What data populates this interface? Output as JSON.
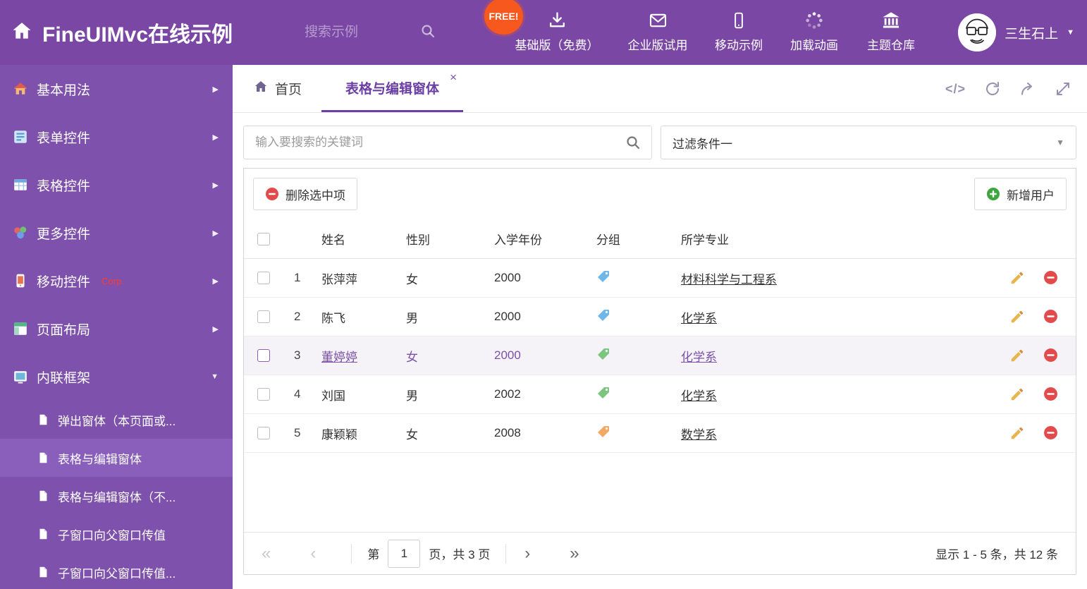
{
  "colors": {
    "brand_purple": "#7A47A5",
    "sidebar_purple": "#7E51AC",
    "sidebar_selected": "#8A5FBC",
    "accent_purple": "#6C3FA4",
    "selected_row_text": "#7A50A8",
    "free_badge_orange": "#F7581D",
    "delete_red": "#E14B4B",
    "add_green": "#3FA63F",
    "pencil_orange": "#E8B44C"
  },
  "icons": {
    "code": "</>",
    "caret_down": "▼",
    "arrow_right": "▶",
    "close": "×",
    "first": "«",
    "prev": "‹",
    "next": "›",
    "last": "»"
  },
  "header": {
    "title": "FineUIMvc在线示例",
    "search_placeholder": "搜索示例",
    "free_badge": "FREE!",
    "nav_items": [
      {
        "label": "基础版（免费）"
      },
      {
        "label": "企业版试用"
      },
      {
        "label": "移动示例"
      },
      {
        "label": "加载动画"
      },
      {
        "label": "主题仓库"
      }
    ],
    "user_name": "三生石上"
  },
  "sidebar": {
    "items": [
      {
        "label": "基本用法"
      },
      {
        "label": "表单控件"
      },
      {
        "label": "表格控件"
      },
      {
        "label": "更多控件"
      },
      {
        "label": "移动控件",
        "badge": "Corp."
      },
      {
        "label": "页面布局"
      },
      {
        "label": "内联框架"
      }
    ],
    "subitems": [
      {
        "label": "弹出窗体（本页面或..."
      },
      {
        "label": "表格与编辑窗体"
      },
      {
        "label": "表格与编辑窗体（不..."
      },
      {
        "label": "子窗口向父窗口传值"
      },
      {
        "label": "子窗口向父窗口传值..."
      }
    ]
  },
  "tabs": {
    "home": "首页",
    "active": "表格与编辑窗体"
  },
  "filter": {
    "search_placeholder": "输入要搜索的关键词",
    "dropdown_value": "过滤条件一"
  },
  "toolbar": {
    "delete_label": "删除选中项",
    "add_label": "新增用户"
  },
  "table": {
    "columns": [
      "姓名",
      "性别",
      "入学年份",
      "分组",
      "所学专业"
    ],
    "rows": [
      {
        "num": "1",
        "name": "张萍萍",
        "gender": "女",
        "year": "2000",
        "tag_color": "#6FB7E9",
        "major": "材料科学与工程系"
      },
      {
        "num": "2",
        "name": "陈飞",
        "gender": "男",
        "year": "2000",
        "tag_color": "#6FB7E9",
        "major": "化学系"
      },
      {
        "num": "3",
        "name": "董婷婷",
        "gender": "女",
        "year": "2000",
        "tag_color": "#7CC57F",
        "major": "化学系"
      },
      {
        "num": "4",
        "name": "刘国",
        "gender": "男",
        "year": "2002",
        "tag_color": "#7CC57F",
        "major": "化学系"
      },
      {
        "num": "5",
        "name": "康颖颖",
        "gender": "女",
        "year": "2008",
        "tag_color": "#F2A963",
        "major": "数学系"
      }
    ]
  },
  "pagination": {
    "prefix": "第",
    "page": "1",
    "suffix": "页，共 3 页",
    "summary": "显示 1 - 5 条，共 12 条"
  }
}
